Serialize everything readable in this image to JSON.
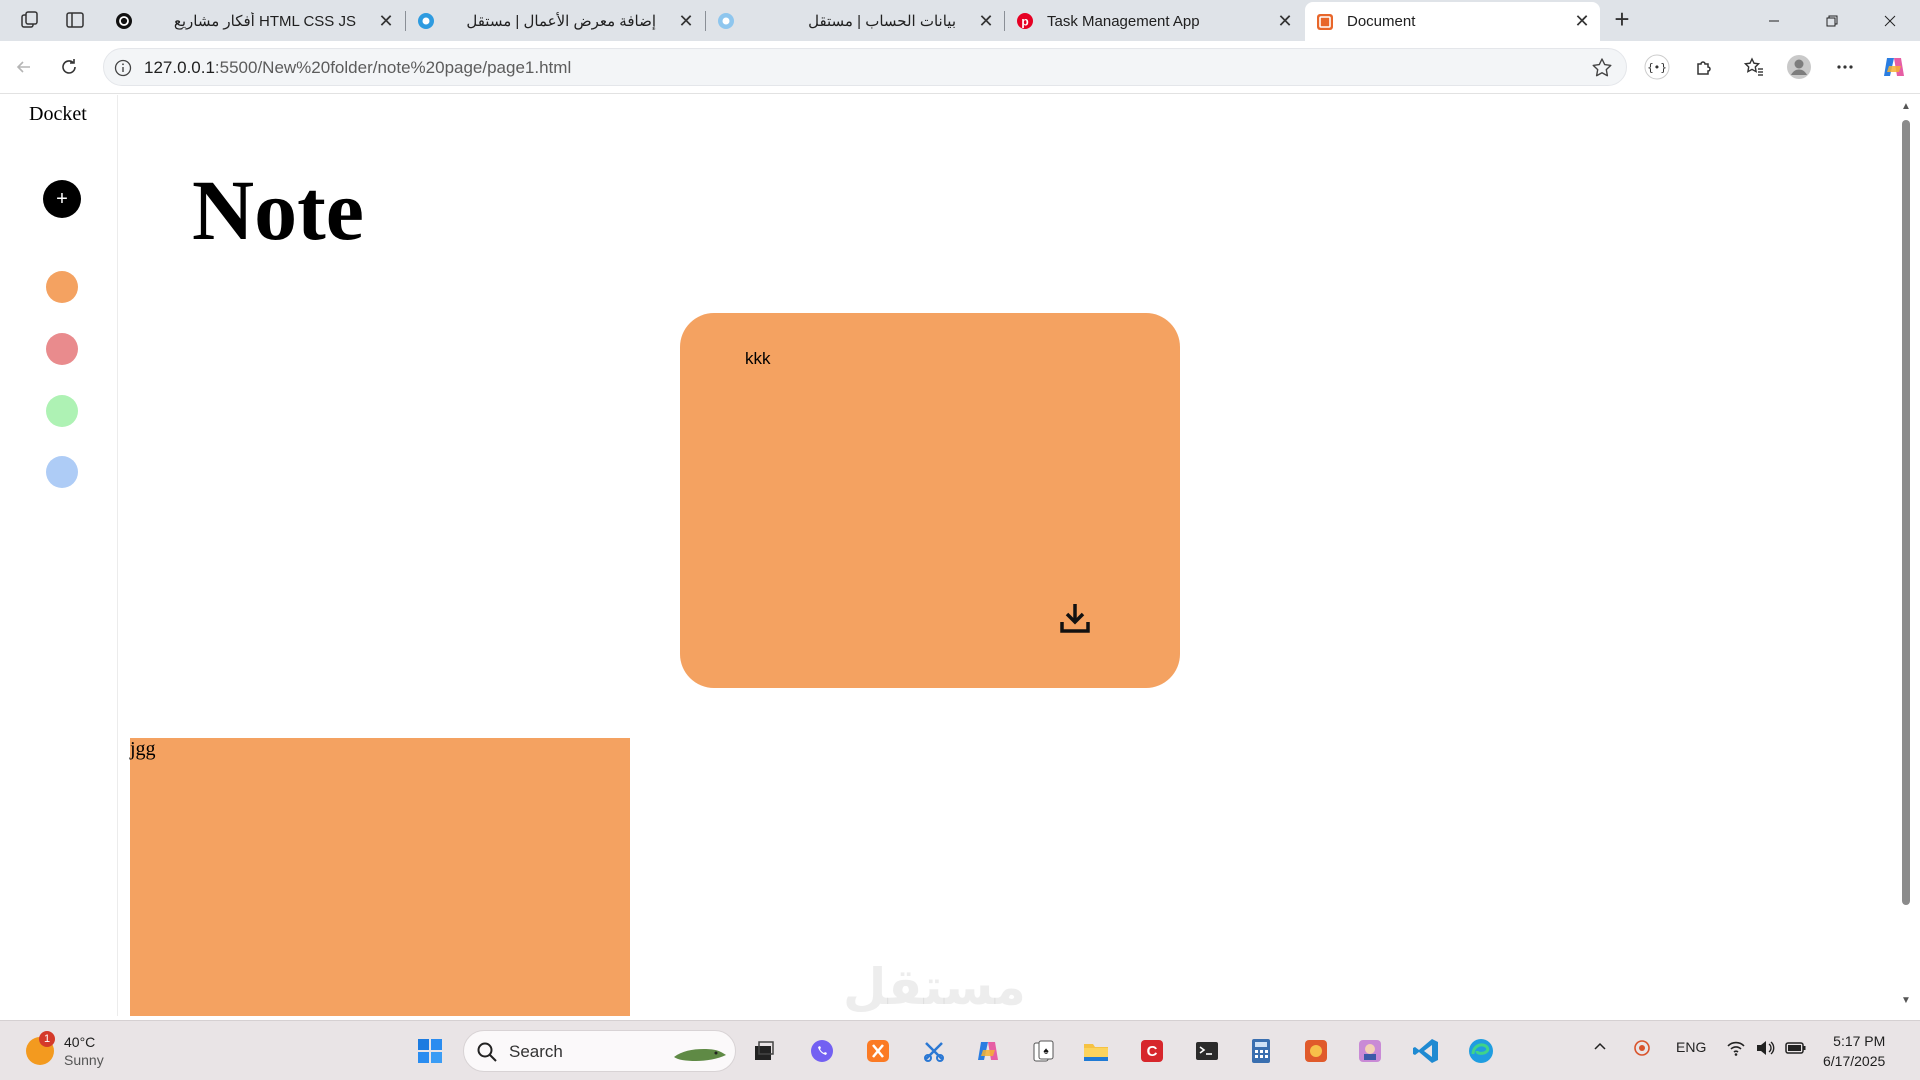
{
  "browser": {
    "tabs": [
      {
        "title": "HTML CSS JS أفكار مشاريع",
        "rtl": true,
        "active": false
      },
      {
        "title": "إضافة معرض الأعمال | مستقل",
        "rtl": true,
        "active": false
      },
      {
        "title": "بيانات الحساب | مستقل",
        "rtl": true,
        "active": false
      },
      {
        "title": "Task Management App",
        "rtl": false,
        "active": false
      },
      {
        "title": "Document",
        "rtl": false,
        "active": true
      }
    ],
    "url_host": "127.0.0.1",
    "url_rest": ":5500/New%20folder/note%20page/page1.html"
  },
  "app": {
    "brand": "Docket",
    "add_label": "+",
    "heading": "Note",
    "swatches": [
      {
        "name": "orange",
        "color": "#f4a261"
      },
      {
        "name": "red",
        "color": "#e98b8d"
      },
      {
        "name": "green",
        "color": "#aef2b4"
      },
      {
        "name": "blue",
        "color": "#aeccf6"
      }
    ],
    "notes": [
      {
        "text": "kkk",
        "color": "#f4a261"
      },
      {
        "text": "jgg",
        "color": "#f4a261"
      }
    ],
    "watermark": "مستقل"
  },
  "taskbar": {
    "weather_badge": "1",
    "temp": "40°C",
    "condition": "Sunny",
    "search_placeholder": "Search",
    "lang": "ENG",
    "time": "5:17 PM",
    "date": "6/17/2025"
  },
  "colors": {
    "tabstrip": "#dfe3e8",
    "note": "#f4a261"
  }
}
